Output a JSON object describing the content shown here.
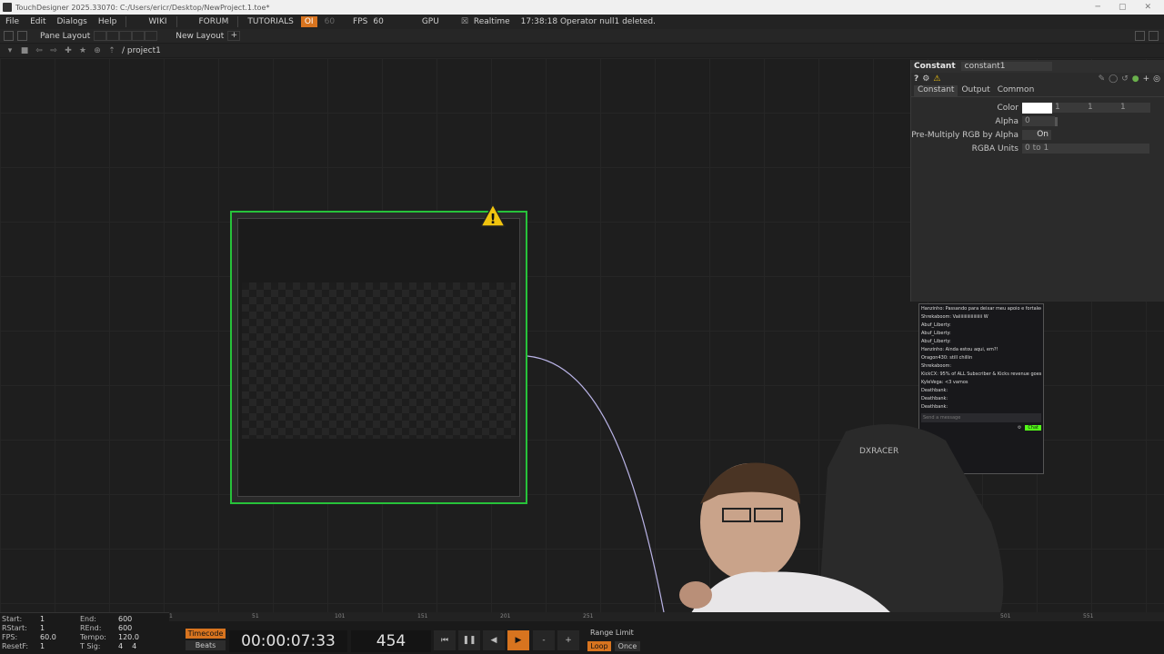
{
  "window": {
    "title": "TouchDesigner 2025.33070: C:/Users/ericr/Desktop/NewProject.1.toe*",
    "minimize": "─",
    "maximize": "▢",
    "close": "✕"
  },
  "menubar": {
    "items": [
      "File",
      "Edit",
      "Dialogs",
      "Help"
    ],
    "wiki": "WIKI",
    "forum": "FORUM",
    "tutorials": "TUTORIALS",
    "oi": "OI",
    "oi_dim": "60",
    "fps_label": "FPS",
    "fps_value": "60",
    "gpu": "GPU",
    "realtime": "Realtime",
    "status": "17:38:18 Operator null1 deleted."
  },
  "toolbar": {
    "pane_layout": "Pane Layout",
    "new_layout": "New Layout",
    "add": "+",
    "path": "/ project1"
  },
  "node": {
    "warning_glyph": "!"
  },
  "params": {
    "op_type": "Constant",
    "op_name": "constant1",
    "tabs": [
      "Constant",
      "Output",
      "Common"
    ],
    "color_label": "Color",
    "color_g": "1",
    "color_b": "1",
    "color_a": "1",
    "alpha_label": "Alpha",
    "alpha_value": "0",
    "premult_label": "Pre-Multiply RGB by Alpha",
    "premult_value": "On",
    "rgba_label": "RGBA Units",
    "rgba_value": "0 to 1"
  },
  "chat": {
    "lines": [
      "Hanzinho: Passando para deixar meu apoio e fortalecer essa família que está sendo construída aqui.",
      "Shrekaboom: Vaiiiiiiiiiiiiiiiiiii W",
      "Abuf_Liberty:",
      "Abuf_Liberty:",
      "Abuf_Liberty:",
      "Hanzinho: Ainda estou aqui, em?!",
      "Oragon430: still chillin",
      "Shrekaboom:",
      "KickCX: 95% of ALL Subscriber & Kicks revenue goes to MadTV. Support Mad today!",
      "KyleVega: <3 vamos",
      "Deathbank:",
      "Deathbank:",
      "Deathbank:"
    ],
    "placeholder": "Send a message",
    "chat_button": "Chat"
  },
  "timeline": {
    "ruler_ticks": [
      "1",
      "51",
      "101",
      "151",
      "201",
      "251",
      "501",
      "551"
    ],
    "start_label": "Start:",
    "start_value": "1",
    "end_label": "End:",
    "end_value": "600",
    "rstart_label": "RStart:",
    "rstart_value": "1",
    "rend_label": "REnd:",
    "rend_value": "600",
    "fps_label": "FPS:",
    "fps_value": "60.0",
    "tempo_label": "Tempo:",
    "tempo_value": "120.0",
    "resetf_label": "ResetF:",
    "resetf_value": "1",
    "tsig_label": "T Sig:",
    "tsig_value_a": "4",
    "tsig_value_b": "4",
    "timecode_button": "Timecode",
    "beats_button": "Beats",
    "timecode": "00:00:07:33",
    "frame": "454",
    "range_limit": "Range Limit",
    "loop": "Loop",
    "once": "Once"
  },
  "colors": {
    "accent_orange": "#d8741f",
    "node_selected_green": "#27c23a",
    "wire": "#b9b3e6"
  }
}
